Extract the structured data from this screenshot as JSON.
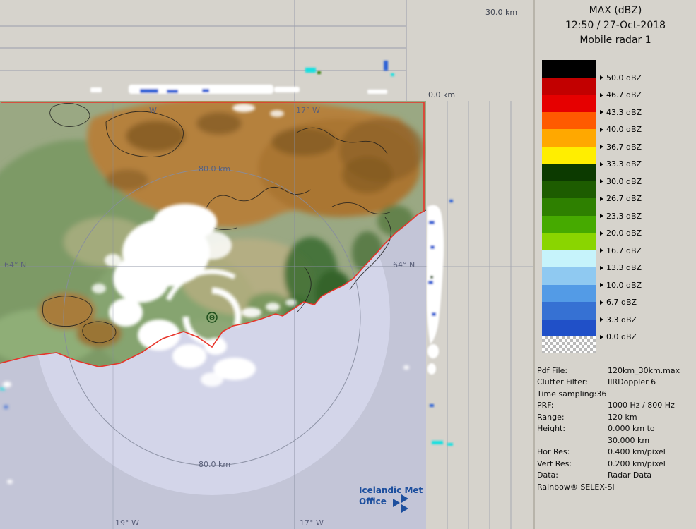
{
  "palette": {
    "panel_bg": "#d6d3cc",
    "ocean_outer": "#c3c5d7",
    "ocean_inner": "#d3d5e9",
    "land_base": "#9aa883",
    "land_green": "#7d9a66",
    "land_brown": "#b5813e",
    "land_brown_dark": "#7e5722",
    "land_tan": "#c2b184",
    "land_darkgreen": "#3f6f33",
    "echo_white": "#ffffff",
    "boundary_red": "#e8342a",
    "grid_gray": "#878da0",
    "contour_black": "#1c1c1c",
    "logo_blue": "#1d4f9e",
    "map_label_gray": "#5a607a"
  },
  "header": {
    "product": "MAX (dBZ)",
    "datetime": "12:50 / 27-Oct-2018",
    "radar": "Mobile radar 1"
  },
  "top_panel": {
    "axis_max": "30.0 km",
    "axis_min": "0.0 km"
  },
  "map_labels": {
    "ring_top": "80.0 km",
    "ring_bottom": "80.0 km",
    "lat_left": "64° N",
    "lat_right": "64° N",
    "lon_top_left": "W",
    "lon_top_right": "17° W",
    "lon_bottom_left": "19° W",
    "lon_bottom_right": "17° W"
  },
  "logo": {
    "line1": "Icelandic Met",
    "line2": "Office"
  },
  "legend": {
    "unit": "dBZ",
    "entries": [
      {
        "label": "50.0 dBZ",
        "color": "#000000"
      },
      {
        "label": "46.7 dBZ",
        "color": "#c20000"
      },
      {
        "label": "43.3 dBZ",
        "color": "#e60000"
      },
      {
        "label": "40.0 dBZ",
        "color": "#ff5a00"
      },
      {
        "label": "36.7 dBZ",
        "color": "#ffa800"
      },
      {
        "label": "33.3 dBZ",
        "color": "#ffee00"
      },
      {
        "label": "30.0 dBZ",
        "color": "#0c3a00"
      },
      {
        "label": "26.7 dBZ",
        "color": "#1d5c00"
      },
      {
        "label": "23.3 dBZ",
        "color": "#2e8000"
      },
      {
        "label": "20.0 dBZ",
        "color": "#46aa00"
      },
      {
        "label": "16.7 dBZ",
        "color": "#8ad500"
      },
      {
        "label": "13.3 dBZ",
        "color": "#c6f3fb"
      },
      {
        "label": "10.0 dBZ",
        "color": "#8fc9f1"
      },
      {
        "label": "6.7 dBZ",
        "color": "#539be6"
      },
      {
        "label": "3.3 dBZ",
        "color": "#3671d3"
      },
      {
        "label": "0.0 dBZ",
        "color": "#2050c8"
      }
    ]
  },
  "info": {
    "rows": [
      {
        "label": "Pdf File:",
        "value": "120km_30km.max"
      },
      {
        "label": "Clutter Filter:",
        "value": "IIRDoppler 6"
      },
      {
        "label": "Time sampling:36",
        "value": ""
      },
      {
        "label": "PRF:",
        "value": "1000 Hz / 800 Hz"
      },
      {
        "label": "Range:",
        "value": "120 km"
      },
      {
        "label": "Height:",
        "value": "0.000 km to"
      },
      {
        "label": "",
        "value": "30.000 km"
      },
      {
        "label": "Hor Res:",
        "value": "0.400 km/pixel"
      },
      {
        "label": "Vert Res:",
        "value": "0.200 km/pixel"
      },
      {
        "label": "Data:",
        "value": "Radar Data"
      }
    ],
    "footer": "Rainbow® SELEX-SI"
  }
}
